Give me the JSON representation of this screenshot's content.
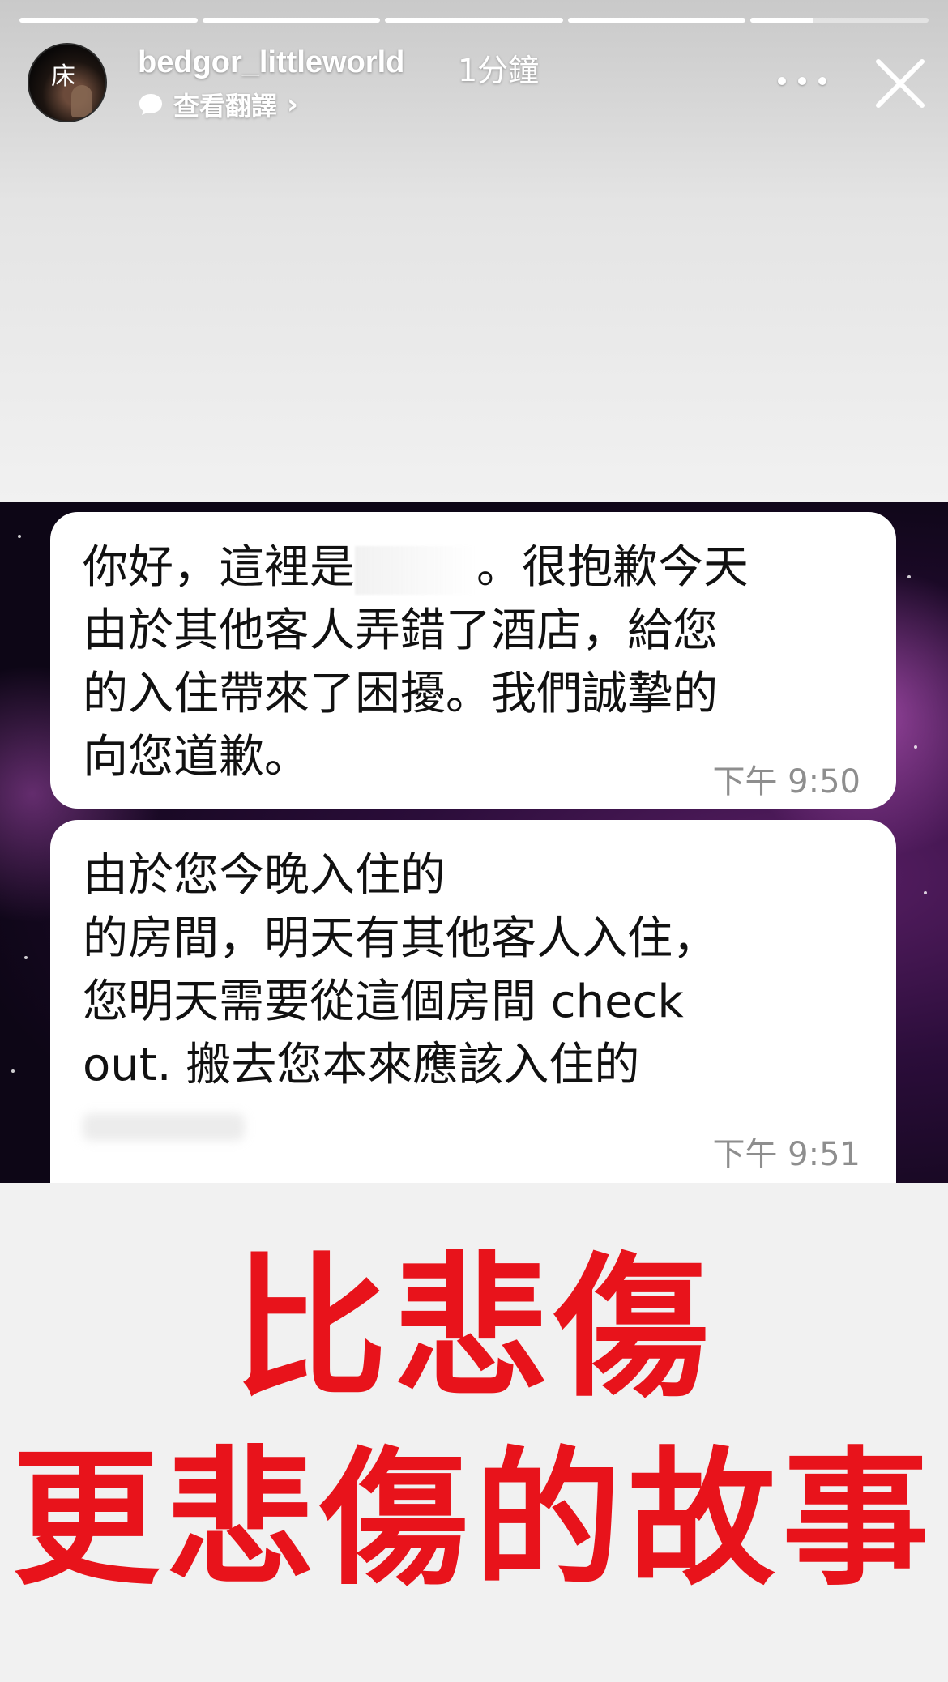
{
  "story": {
    "progress_segments": [
      1,
      1,
      1,
      1,
      0.35
    ]
  },
  "header": {
    "avatar_glyph": "床",
    "username": "bedgor_littleworld",
    "time_ago": "1分鐘",
    "translate_label": "查看翻譯",
    "translate_chevron": "›"
  },
  "messages": [
    {
      "lines_before_redact": "你好，這裡是",
      "after_redact": "。很抱歉今天\n由於其他客人弄錯了酒店，給您\n的入住帶來了困擾。我們誠摯的\n向您道歉。",
      "time": "下午 9:50"
    },
    {
      "text": "由於您今晚入住的\n的房間，明天有其他客人入住，\n您明天需要從這個房間 check\nout. 搬去您本來應該入住的",
      "time": "下午 9:51"
    }
  ],
  "caption": {
    "line1": "比悲傷",
    "line2": "更悲傷的故事"
  },
  "colors": {
    "caption": "#e8131b",
    "background": "#f1f1f1"
  }
}
